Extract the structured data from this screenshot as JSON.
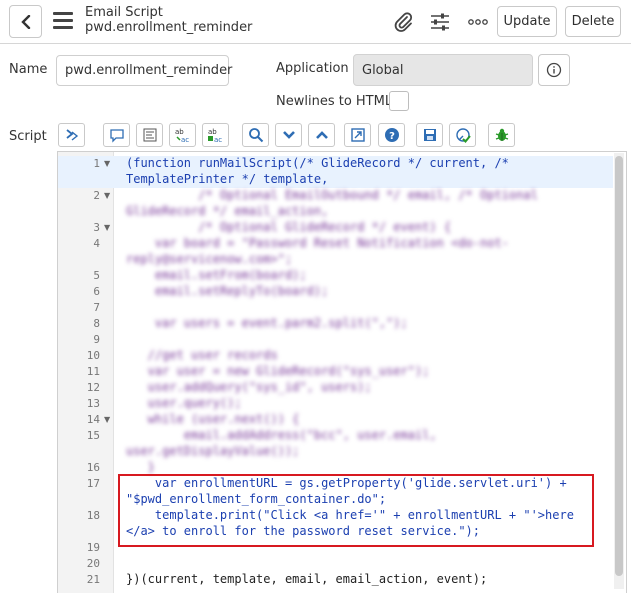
{
  "header": {
    "record_type": "Email Script",
    "record_name": "pwd.enrollment_reminder",
    "update_label": "Update",
    "delete_label": "Delete"
  },
  "form": {
    "name_label": "Name",
    "name_value": "pwd.enrollment_reminder",
    "application_label": "Application",
    "application_value": "Global",
    "newlines_label": "Newlines to HTML",
    "newlines_checked": false,
    "script_label": "Script"
  },
  "editor": {
    "lines": [
      {
        "num": "1",
        "fold": true,
        "text": "(function runMailScript(/* GlideRecord */ current, /*"
      },
      {
        "num": "",
        "fold": false,
        "text": "TemplatePrinter */ template,"
      },
      {
        "num": "2",
        "fold": true,
        "text": "          /* Optional EmailOutbound */ email, /* Optional"
      },
      {
        "num": "",
        "fold": false,
        "text": "GlideRecord */ email_action,"
      },
      {
        "num": "3",
        "fold": true,
        "text": "          /* Optional GlideRecord */ event) {"
      },
      {
        "num": "4",
        "fold": false,
        "text": "    var board = \"Password Reset Notification <do-not-"
      },
      {
        "num": "",
        "fold": false,
        "text": "reply@servicenow.com>\";"
      },
      {
        "num": "5",
        "fold": false,
        "text": "    email.setFrom(board);"
      },
      {
        "num": "6",
        "fold": false,
        "text": "    email.setReplyTo(board);"
      },
      {
        "num": "7",
        "fold": false,
        "text": ""
      },
      {
        "num": "8",
        "fold": false,
        "text": "    var users = event.parm2.split(\",\");"
      },
      {
        "num": "9",
        "fold": false,
        "text": ""
      },
      {
        "num": "10",
        "fold": false,
        "text": "   //get user records"
      },
      {
        "num": "11",
        "fold": false,
        "text": "   var user = new GlideRecord(\"sys_user\");"
      },
      {
        "num": "12",
        "fold": false,
        "text": "   user.addQuery(\"sys_id\", users);"
      },
      {
        "num": "13",
        "fold": false,
        "text": "   user.query();"
      },
      {
        "num": "14",
        "fold": true,
        "text": "   while (user.next()) {"
      },
      {
        "num": "15",
        "fold": false,
        "text": "        email.addAddress(\"bcc\", user.email,"
      },
      {
        "num": "",
        "fold": false,
        "text": "user.getDisplayValue());"
      },
      {
        "num": "16",
        "fold": false,
        "text": "   }"
      },
      {
        "num": "17",
        "fold": false,
        "text": "    var enrollmentURL = gs.getProperty('glide.servlet.uri') +"
      },
      {
        "num": "",
        "fold": false,
        "text": "\"$pwd_enrollment_form_container.do\";"
      },
      {
        "num": "18",
        "fold": false,
        "text": "    template.print(\"Click <a href='\" + enrollmentURL + \"'>here"
      },
      {
        "num": "",
        "fold": false,
        "text": "</a> to enroll for the password reset service.\");"
      },
      {
        "num": "19",
        "fold": false,
        "text": ""
      },
      {
        "num": "20",
        "fold": false,
        "text": ""
      },
      {
        "num": "21",
        "fold": false,
        "text": "})(current, template, email, email_action, event);"
      }
    ]
  },
  "colors": {
    "highlight_box": "#d71920",
    "active_line": "#e8f2fe",
    "toolbar_icon": "#2e6db4"
  }
}
